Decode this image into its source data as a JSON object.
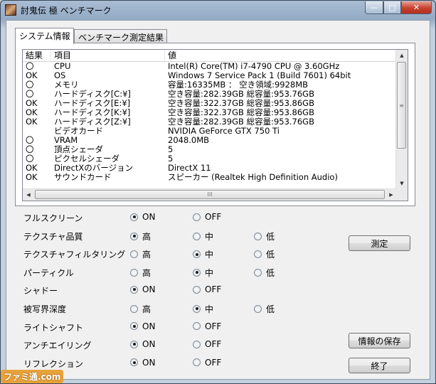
{
  "window": {
    "title": "討鬼伝 極 ベンチマーク",
    "min_symbol": "—",
    "max_symbol": "□",
    "close_symbol": "✕"
  },
  "tabs": [
    {
      "label": "システム情報",
      "active": true
    },
    {
      "label": "ベンチマーク測定結果",
      "active": false
    }
  ],
  "list": {
    "headers": [
      "結果",
      "項目",
      "値"
    ],
    "rows": [
      {
        "result": "〇",
        "item": "CPU",
        "value": "Intel(R) Core(TM) i7-4790 CPU @ 3.60GHz"
      },
      {
        "result": "OK",
        "item": "OS",
        "value": "Windows 7 Service Pack 1 (Build 7601) 64bit"
      },
      {
        "result": "〇",
        "item": "メモリ",
        "value": "容量:16335MB ： 空き領域:9928MB"
      },
      {
        "result": "〇",
        "item": "ハードディスク[C:¥]",
        "value": "空き容量:282.39GB  総容量:953.76GB"
      },
      {
        "result": "OK",
        "item": "ハードディスク[E:¥]",
        "value": "空き容量:322.37GB  総容量:953.86GB"
      },
      {
        "result": "OK",
        "item": "ハードディスク[K:¥]",
        "value": "空き容量:322.37GB  総容量:953.86GB"
      },
      {
        "result": "OK",
        "item": "ハードディスク[Z:¥]",
        "value": "空き容量:282.39GB  総容量:953.76GB"
      },
      {
        "result": "",
        "item": "ビデオカード",
        "value": "NVIDIA GeForce GTX 750 Ti"
      },
      {
        "result": "〇",
        "item": "VRAM",
        "value": "2048.0MB"
      },
      {
        "result": "〇",
        "item": "頂点シェーダ",
        "value": "5"
      },
      {
        "result": "〇",
        "item": "ピクセルシェーダ",
        "value": "5"
      },
      {
        "result": "OK",
        "item": "DirectXのバージョン",
        "value": "DirectX 11"
      },
      {
        "result": "OK",
        "item": "サウンドカード",
        "value": "スピーカー (Realtek High Definition Audio)"
      }
    ],
    "scroll_up": "▲",
    "scroll_down": "▼",
    "scroll_left": "◀",
    "scroll_right": "▶",
    "vthumb_grip": "≡",
    "hthumb_grip": "III"
  },
  "settings": [
    {
      "label": "フルスクリーン",
      "options": [
        "ON",
        "OFF"
      ],
      "selected": 0
    },
    {
      "label": "テクスチャ品質",
      "options": [
        "高",
        "中",
        "低"
      ],
      "selected": 0
    },
    {
      "label": "テクスチャフィルタリング",
      "options": [
        "高",
        "中",
        "低"
      ],
      "selected": 1
    },
    {
      "label": "パーティクル",
      "options": [
        "高",
        "中",
        "低"
      ],
      "selected": 1
    },
    {
      "label": "シャドー",
      "options": [
        "ON",
        "OFF"
      ],
      "selected": 0
    },
    {
      "label": "被写界深度",
      "options": [
        "高",
        "中",
        "低"
      ],
      "selected": 1
    },
    {
      "label": "ライトシャフト",
      "options": [
        "ON",
        "OFF"
      ],
      "selected": 0
    },
    {
      "label": "アンチエイリング",
      "options": [
        "ON",
        "OFF"
      ],
      "selected": 0
    },
    {
      "label": "リフレクション",
      "options": [
        "ON",
        "OFF"
      ],
      "selected": 0
    }
  ],
  "buttons": {
    "measure": "測定",
    "save_info": "情報の保存",
    "exit": "終了"
  },
  "watermark": "ファミ通.com"
}
